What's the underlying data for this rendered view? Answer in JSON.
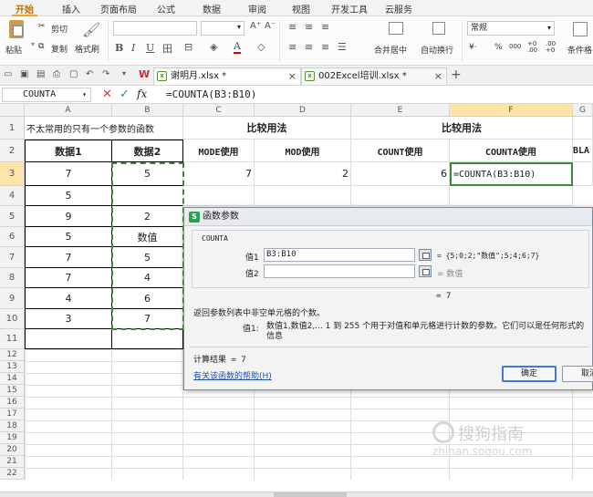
{
  "ribbon_tabs": [
    "开始",
    "插入",
    "页面布局",
    "公式",
    "数据",
    "审阅",
    "视图",
    "开发工具",
    "云服务"
  ],
  "ribbon": {
    "paste": "粘贴",
    "cut": "剪切",
    "copy": "复制",
    "format_painter": "格式刷",
    "bold": "B",
    "italic": "I",
    "underline": "U",
    "font_grow": "A⁺",
    "font_shrink": "A⁻",
    "merge_center": "合并居中",
    "wrap_text": "自动换行",
    "number_format": "常规",
    "percent": "%",
    "comma": "000",
    "inc_decimal": "+0 .00",
    "dec_decimal": ".00 +0",
    "conditional_format": "条件格"
  },
  "doc_tabs": [
    {
      "name": "谢明月.xlsx *",
      "active": true
    },
    {
      "name": "002Excel培训.xlsx *",
      "active": false
    }
  ],
  "formula_bar": {
    "name_box": "COUNTA",
    "cancel": "✕",
    "confirm": "✓",
    "fx": "fx",
    "formula": "=COUNTA(B3:B10)"
  },
  "columns": [
    "A",
    "B",
    "C",
    "D",
    "E",
    "F",
    "G"
  ],
  "rows": [
    "1",
    "2",
    "3",
    "4",
    "5",
    "6",
    "7",
    "8",
    "9",
    "10",
    "11",
    "12",
    "13",
    "14",
    "15",
    "16",
    "17",
    "18",
    "19",
    "20",
    "21",
    "22"
  ],
  "sheet": {
    "a1": "不太常用的只有一个参数的函数",
    "cd1": "比较用法",
    "ef1": "比较用法",
    "a2": "数据1",
    "b2": "数据2",
    "c2": "MODE使用",
    "d2": "MOD使用",
    "e2": "COUNT使用",
    "f2": "COUNTA使用",
    "g2": "BLA",
    "a3": "7",
    "b3": "5",
    "c3": "7",
    "d3": "2",
    "e3": "6",
    "f3": "=COUNTA(B3:B10)",
    "a4": "5",
    "b4": "",
    "a5": "9",
    "b5": "2",
    "a6": "5",
    "b6": "数值",
    "a7": "7",
    "b7": "5",
    "a8": "7",
    "b8": "4",
    "a9": "4",
    "b9": "6",
    "a10": "3",
    "b10": "7"
  },
  "dialog": {
    "title": "函数参数",
    "function_name": "COUNTA",
    "arg1_label": "值1",
    "arg1_value": "B3:B10",
    "arg1_result": "= {5;0;2;\"数值\";5;4;6;7}",
    "arg2_label": "值2",
    "arg2_result": "= 数值",
    "formula_result": "= 7",
    "description": "返回参数列表中非空单元格的个数。",
    "param_label": "值1:",
    "param_desc": "数值1,数值2,... 1 到 255 个用于对值和单元格进行计数的参数。它们可以是任何形式的信息",
    "calc_result": "计算结果 = 7",
    "help_link": "有关该函数的帮助(H)",
    "ok": "确定",
    "cancel": "取消"
  },
  "watermark": {
    "main": "搜狗指南",
    "sub": "zhinan.sogou.com"
  }
}
